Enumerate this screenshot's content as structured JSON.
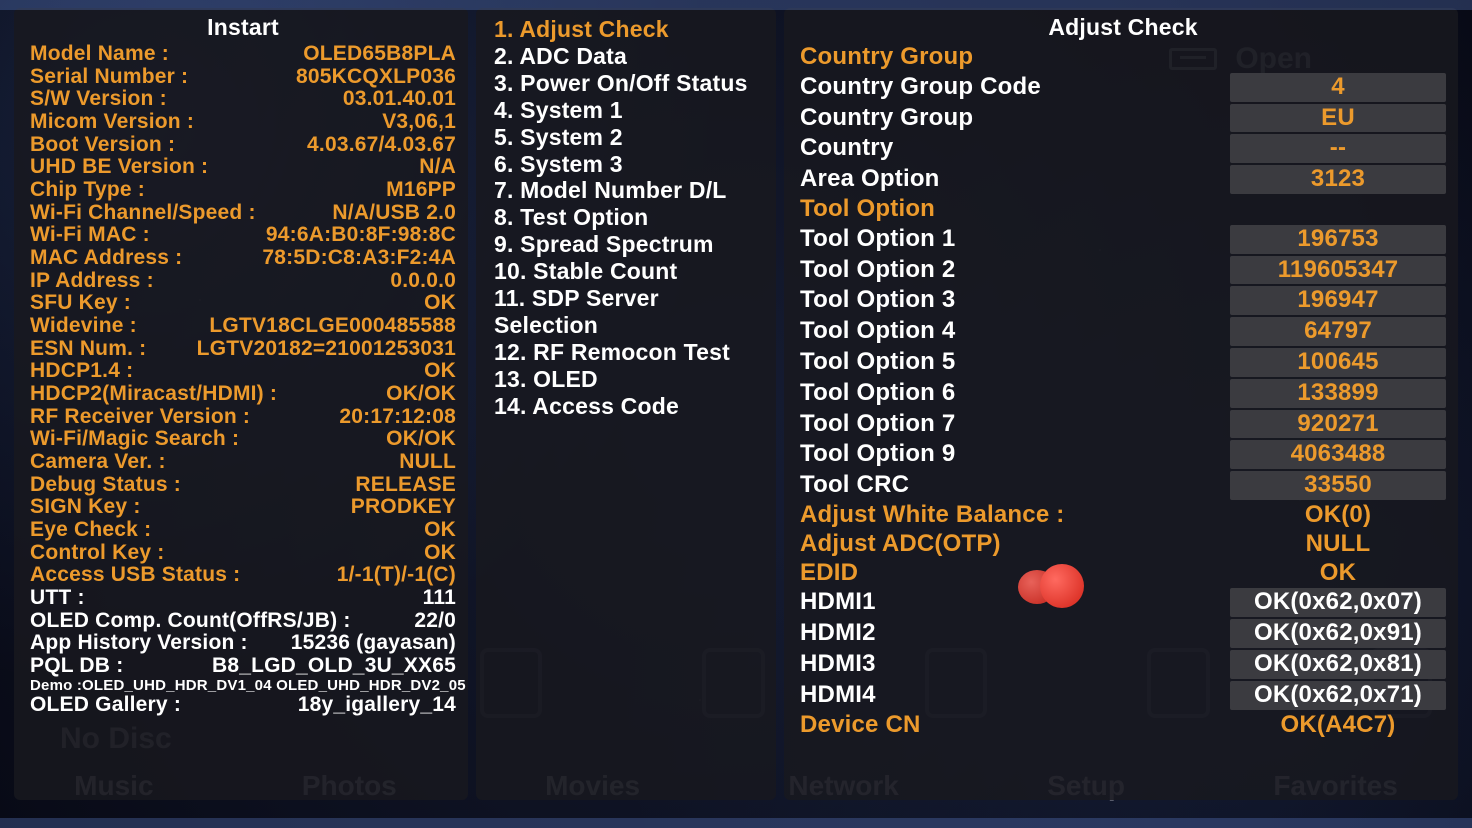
{
  "left": {
    "title": "Instart",
    "rows": [
      {
        "label": "Model Name :",
        "value": "OLED65B8PLA",
        "c": "o"
      },
      {
        "label": "Serial Number :",
        "value": "805KCQXLP036",
        "c": "o"
      },
      {
        "label": "S/W Version :",
        "value": "03.01.40.01",
        "c": "o"
      },
      {
        "label": "Micom Version :",
        "value": "V3,06,1",
        "c": "o"
      },
      {
        "label": "Boot Version :",
        "value": "4.03.67/4.03.67",
        "c": "o"
      },
      {
        "label": "UHD BE Version :",
        "value": "N/A",
        "c": "o"
      },
      {
        "label": "Chip Type :",
        "value": "M16PP",
        "c": "o"
      },
      {
        "label": "Wi-Fi Channel/Speed :",
        "value": "N/A/USB 2.0",
        "c": "o"
      },
      {
        "label": "Wi-Fi MAC :",
        "value": "94:6A:B0:8F:98:8C",
        "c": "o"
      },
      {
        "label": "MAC Address :",
        "value": "78:5D:C8:A3:F2:4A",
        "c": "o"
      },
      {
        "label": "IP Address :",
        "value": "0.0.0.0",
        "c": "o"
      },
      {
        "label": "SFU Key :",
        "value": "OK",
        "c": "o"
      },
      {
        "label": "Widevine :",
        "value": "LGTV18CLGE000485588",
        "c": "o"
      },
      {
        "label": "ESN Num. :",
        "value": "LGTV20182=21001253031",
        "c": "o"
      },
      {
        "label": "HDCP1.4 :",
        "value": "OK",
        "c": "o"
      },
      {
        "label": "HDCP2(Miracast/HDMI) :",
        "value": "OK/OK",
        "c": "o"
      },
      {
        "label": "RF Receiver Version :",
        "value": "20:17:12:08",
        "c": "o"
      },
      {
        "label": "Wi-Fi/Magic Search :",
        "value": "OK/OK",
        "c": "o"
      },
      {
        "label": "Camera Ver. :",
        "value": "NULL",
        "c": "o"
      },
      {
        "label": "Debug Status :",
        "value": "RELEASE",
        "c": "o"
      },
      {
        "label": "SIGN Key :",
        "value": "PRODKEY",
        "c": "o"
      },
      {
        "label": "Eye Check :",
        "value": "OK",
        "c": "o"
      },
      {
        "label": "Control Key :",
        "value": "OK",
        "c": "o"
      },
      {
        "label": "Access USB Status :",
        "value": "1/-1(T)/-1(C)",
        "c": "o"
      },
      {
        "label": "UTT :",
        "value": "111",
        "c": "w"
      },
      {
        "label": "OLED Comp. Count(OffRS/JB) :",
        "value": "22/0",
        "c": "w"
      },
      {
        "label": "App History Version :",
        "value": "15236 (gayasan)",
        "c": "w"
      },
      {
        "label": "PQL DB :",
        "value": "B8_LGD_OLD_3U_XX65",
        "c": "w"
      },
      {
        "label": "Demo :",
        "value": "OLED_UHD_HDR_DV1_04 OLED_UHD_HDR_DV2_05",
        "c": "w",
        "size": "xsmall"
      },
      {
        "label": "OLED Gallery :",
        "value": "18y_igallery_14",
        "c": "w"
      }
    ]
  },
  "mid": {
    "items": [
      {
        "n": "1",
        "label": "Adjust Check",
        "selected": true
      },
      {
        "n": "2",
        "label": "ADC Data"
      },
      {
        "n": "3",
        "label": "Power On/Off Status"
      },
      {
        "n": "4",
        "label": "System 1"
      },
      {
        "n": "5",
        "label": "System 2"
      },
      {
        "n": "6",
        "label": "System 3"
      },
      {
        "n": "7",
        "label": "Model Number D/L"
      },
      {
        "n": "8",
        "label": "Test Option"
      },
      {
        "n": "9",
        "label": "Spread Spectrum"
      },
      {
        "n": "10",
        "label": "Stable Count"
      },
      {
        "n": "11",
        "label": "SDP Server Selection"
      },
      {
        "n": "12",
        "label": "RF Remocon Test"
      },
      {
        "n": "13",
        "label": "OLED"
      },
      {
        "n": "14",
        "label": "Access Code"
      }
    ]
  },
  "right": {
    "title": "Adjust Check",
    "rows": [
      {
        "label": "Country Group",
        "hdr": true
      },
      {
        "label": "Country Group Code",
        "value": "4",
        "box": true
      },
      {
        "label": "Country Group",
        "value": "EU",
        "box": true
      },
      {
        "label": "Country",
        "value": "--",
        "box": true
      },
      {
        "label": "Area Option",
        "value": "3123",
        "box": true
      },
      {
        "label": "Tool Option",
        "hdr": true
      },
      {
        "label": "Tool Option 1",
        "value": "196753",
        "box": true
      },
      {
        "label": "Tool Option 2",
        "value": "119605347",
        "box": true
      },
      {
        "label": "Tool Option 3",
        "value": "196947",
        "box": true
      },
      {
        "label": "Tool Option 4",
        "value": "64797",
        "box": true
      },
      {
        "label": "Tool Option 5",
        "value": "100645",
        "box": true
      },
      {
        "label": "Tool Option 6",
        "value": "133899",
        "box": true
      },
      {
        "label": "Tool Option 7",
        "value": "920271",
        "box": true
      },
      {
        "label": "Tool Option 9",
        "value": "4063488",
        "box": true
      },
      {
        "label": "Tool CRC",
        "value": "33550",
        "box": true
      },
      {
        "label": "Adjust White Balance :",
        "value": "OK(0)",
        "hdr": true,
        "valstyle": "plain-orange"
      },
      {
        "label": "Adjust ADC(OTP)",
        "value": "NULL",
        "hdr": true,
        "valstyle": "plain-orange"
      },
      {
        "label": "EDID",
        "value": "OK",
        "hdr": true,
        "valstyle": "plain-orange"
      },
      {
        "label": "HDMI1",
        "value": "OK(0x62,0x07)",
        "box": true,
        "valstyle": "plain-white"
      },
      {
        "label": "HDMI2",
        "value": "OK(0x62,0x91)",
        "box": true,
        "valstyle": "plain-white"
      },
      {
        "label": "HDMI3",
        "value": "OK(0x62,0x81)",
        "box": true,
        "valstyle": "plain-white"
      },
      {
        "label": "HDMI4",
        "value": "OK(0x62,0x71)",
        "box": true,
        "valstyle": "plain-white"
      },
      {
        "label": "Device CN",
        "value": "OK(A4C7)",
        "hdr": true,
        "valstyle": "plain-orange"
      }
    ]
  },
  "bg": {
    "open": "Open",
    "nodisc": "No Disc",
    "tabs": [
      "Music",
      "Photos",
      "Movies",
      "Network",
      "Setup",
      "Favorites"
    ]
  }
}
